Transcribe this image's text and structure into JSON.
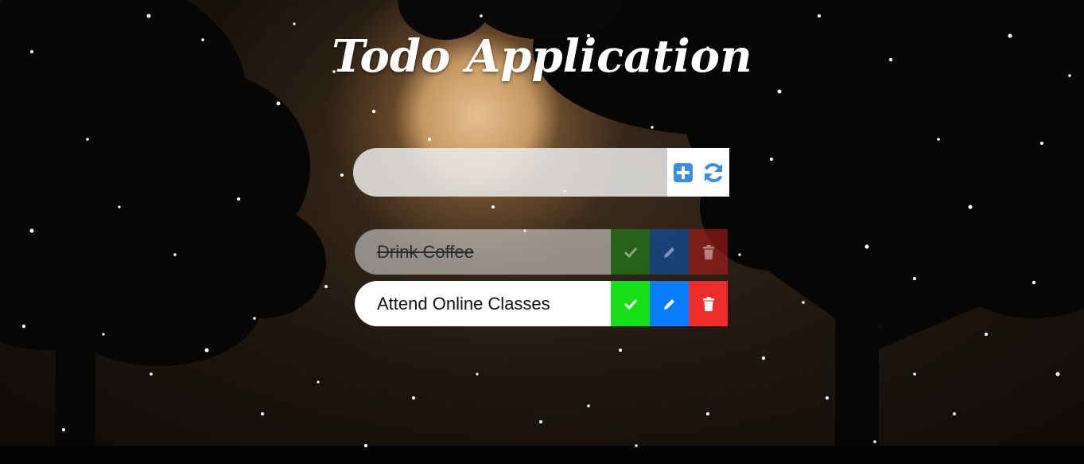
{
  "app": {
    "title": "Todo Application"
  },
  "input": {
    "value": "",
    "placeholder": "",
    "add_icon": "plus-square-icon",
    "reset_icon": "refresh-icon"
  },
  "todos": [
    {
      "text": "Drink Coffee",
      "completed": true
    },
    {
      "text": "Attend Online Classes",
      "completed": false
    }
  ],
  "colors": {
    "check": "#18e018",
    "edit": "#0a7cff",
    "delete": "#ee2c2c",
    "accent": "#3a8ee6"
  }
}
